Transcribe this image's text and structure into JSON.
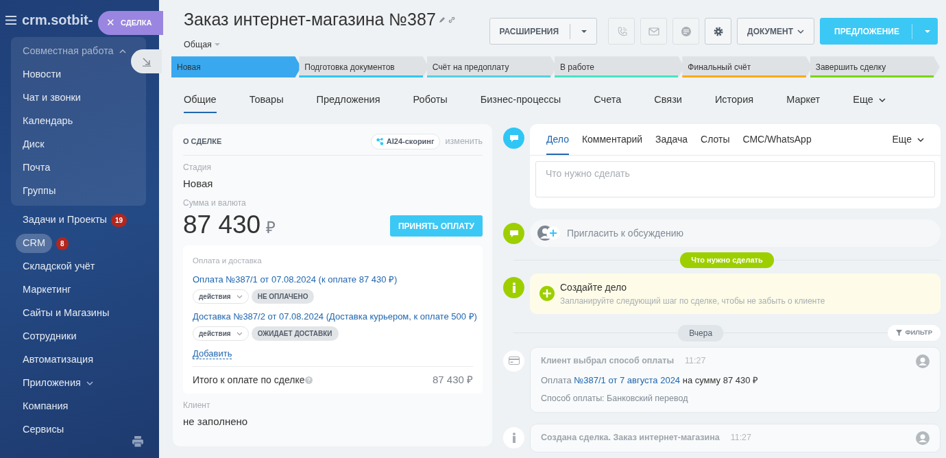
{
  "sidebar": {
    "logo": "crm.sotbit-",
    "group": {
      "title": "Совместная работа",
      "expanded": true,
      "items": [
        {
          "label": "Новости"
        },
        {
          "label": "Чат и звонки"
        },
        {
          "label": "Календарь"
        },
        {
          "label": "Диск"
        },
        {
          "label": "Почта"
        },
        {
          "label": "Группы"
        }
      ]
    },
    "items": [
      {
        "label": "Задачи и Проекты",
        "counter": "19",
        "selected": false,
        "kind": "link"
      },
      {
        "label": "CRM",
        "counter": "8",
        "selected": true,
        "kind": "link"
      },
      {
        "label": "Складской учёт",
        "selected": false,
        "kind": "link"
      },
      {
        "label": "Маркетинг",
        "selected": false,
        "kind": "link"
      },
      {
        "label": "Сайты и Магазины",
        "selected": false,
        "kind": "link"
      },
      {
        "label": "Сотрудники",
        "selected": false,
        "kind": "link"
      },
      {
        "label": "Автоматизация",
        "selected": false,
        "kind": "link"
      },
      {
        "label": "Приложения",
        "selected": false,
        "kind": "folder",
        "expanded": false
      },
      {
        "label": "Компания",
        "selected": false,
        "kind": "link"
      },
      {
        "label": "Сервисы",
        "selected": false,
        "kind": "link"
      }
    ]
  },
  "slider_tab": {
    "label": "СДЕЛКА",
    "close": "✕"
  },
  "header": {
    "title": "Заказ интернет-магазина №387",
    "category": "Общая",
    "buttons": [
      {
        "kind": "split",
        "label": "РАСШИРЕНИЯ"
      },
      {
        "kind": "phone",
        "disabled": true
      },
      {
        "kind": "mail",
        "disabled": true
      },
      {
        "kind": "chat",
        "disabled": true
      },
      {
        "kind": "settings",
        "disabled": false
      },
      {
        "kind": "dropdown",
        "label": "ДОКУМЕНТ"
      },
      {
        "kind": "primary",
        "label": "ПРЕДЛОЖЕНИЕ"
      }
    ]
  },
  "stages": [
    {
      "label": "Новая",
      "selected": true,
      "color": "#39a8ef"
    },
    {
      "label": "Подготовка документов",
      "selected": false,
      "color": "#2fc6f6"
    },
    {
      "label": "Счёт на предоплату",
      "selected": false,
      "color": "#55d0e0"
    },
    {
      "label": "В работе",
      "selected": false,
      "color": "#47e4c2"
    },
    {
      "label": "Финальный счёт",
      "selected": false,
      "color": "#ffa900"
    },
    {
      "label": "Завершить сделку",
      "selected": false,
      "color": "#7bd500"
    }
  ],
  "tabs": [
    {
      "label": "Общие",
      "selected": true
    },
    {
      "label": "Товары",
      "selected": false
    },
    {
      "label": "Предложения",
      "selected": false
    },
    {
      "label": "Роботы",
      "selected": false
    },
    {
      "label": "Бизнес-процессы",
      "selected": false
    },
    {
      "label": "Счета",
      "selected": false
    },
    {
      "label": "Связи",
      "selected": false
    },
    {
      "label": "История",
      "selected": false
    },
    {
      "label": "Маркет",
      "selected": false
    },
    {
      "label": "Еще",
      "selected": false
    }
  ],
  "deal": {
    "title": "О СДЕЛКЕ",
    "scoring": "AI24-скоринг",
    "edit": "изменить",
    "stage_label": "Стадия",
    "stage_value": "Новая",
    "sum_label": "Сумма и валюта",
    "sum_value": "87 430",
    "currency": "₽",
    "pay_button": "ПРИНЯТЬ ОПЛАТУ",
    "payments": {
      "title": "Оплата и доставка",
      "entries": [
        {
          "link": "Оплата №387/1 от 07.08.2024 (к оплате 87 430 ₽)",
          "action": "действия",
          "status": "НЕ ОПЛАЧЕНО"
        },
        {
          "link": "Доставка №387/2 от 07.08.2024 (Доставка курьером, к оплате 500 ₽)",
          "action": "действия",
          "status": "ОЖИДАЕТ ДОСТАВКИ"
        }
      ],
      "add": "Добавить",
      "total_label": "Итого к оплате по сделке",
      "total_value": "87 430 ₽"
    },
    "client_label": "Клиент",
    "client_value": "не заполнено"
  },
  "timeline": {
    "composer_tabs": [
      {
        "label": "Дело",
        "selected": true
      },
      {
        "label": "Комментарий",
        "selected": false
      },
      {
        "label": "Задача",
        "selected": false
      },
      {
        "label": "Слоты",
        "selected": false
      },
      {
        "label": "СМС/WhatsApp",
        "selected": false
      }
    ],
    "composer_more": "Еще",
    "placeholder": "Что нужно сделать",
    "invite": "Пригласить к обсуждению",
    "todo_divider": "Что нужно сделать",
    "create": {
      "title": "Создайте дело",
      "subtitle": "Запланируйте следующий шаг по сделке, чтобы не забыть о клиенте"
    },
    "date_divider": "Вчера",
    "filter": "ФИЛЬТР",
    "history": [
      {
        "title": "Клиент выбрал способ оплаты",
        "time": "11:27",
        "prefix": "Оплата",
        "link": "№387/1 от 7 августа 2024",
        "suffix": "на сумму 87 430 ₽",
        "detail": "Способ оплаты: Банковский перевод"
      },
      {
        "title": "Создана сделка. Заказ интернет-магазина",
        "time": "11:27"
      }
    ]
  }
}
